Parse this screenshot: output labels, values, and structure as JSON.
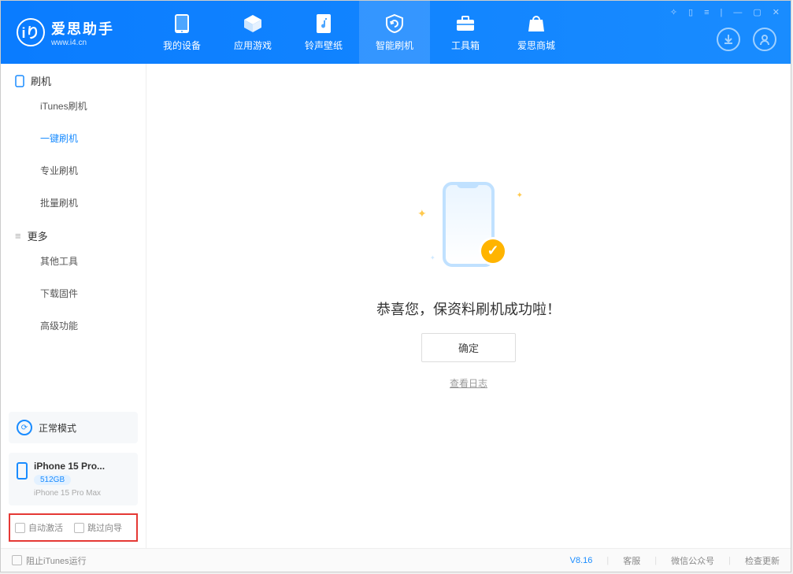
{
  "app": {
    "title": "爱思助手",
    "subtitle": "www.i4.cn"
  },
  "nav": {
    "my_device": "我的设备",
    "apps_games": "应用游戏",
    "ringtones": "铃声壁纸",
    "smart_flash": "智能刷机",
    "toolbox": "工具箱",
    "store": "爱思商城"
  },
  "sidebar": {
    "group_flash": "刷机",
    "itunes_flash": "iTunes刷机",
    "one_click_flash": "一键刷机",
    "pro_flash": "专业刷机",
    "batch_flash": "批量刷机",
    "group_more": "更多",
    "other_tools": "其他工具",
    "download_firmware": "下载固件",
    "advanced": "高级功能"
  },
  "device": {
    "mode": "正常模式",
    "name": "iPhone 15 Pro...",
    "storage": "512GB",
    "model": "iPhone 15 Pro Max"
  },
  "checkboxes": {
    "auto_activate": "自动激活",
    "skip_wizard": "跳过向导"
  },
  "main": {
    "success_text": "恭喜您，保资料刷机成功啦！",
    "confirm": "确定",
    "view_log": "查看日志"
  },
  "footer": {
    "block_itunes": "阻止iTunes运行",
    "version": "V8.16",
    "support": "客服",
    "wechat": "微信公众号",
    "check_update": "检查更新"
  }
}
